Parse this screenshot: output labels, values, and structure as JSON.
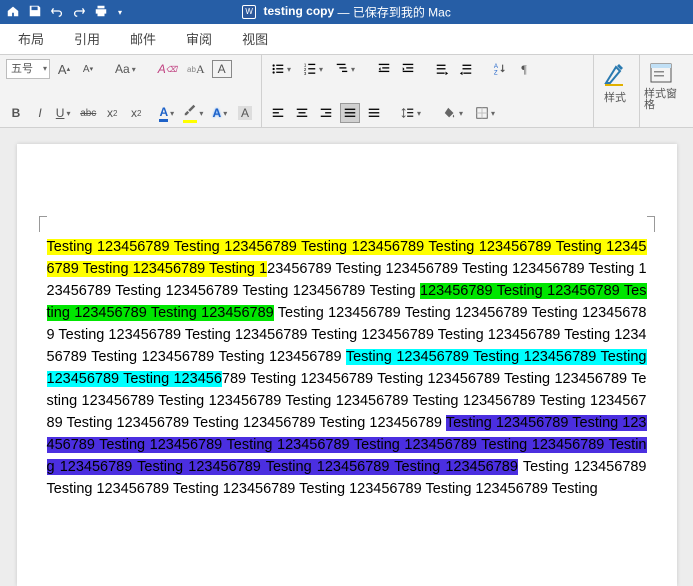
{
  "titlebar": {
    "doc_name": "testing copy",
    "status_text": " — 已保存到我的 Mac"
  },
  "tabs": {
    "t1": "布局",
    "t2": "引用",
    "t3": "邮件",
    "t4": "审阅",
    "t5": "视图"
  },
  "ribbon": {
    "font_size": "五号",
    "grow_font": "A",
    "shrink_font": "A",
    "change_case": "Aa",
    "clear_fmt": "A",
    "phonetic": "A",
    "char_border": "A",
    "bold": "B",
    "italic": "I",
    "underline": "U",
    "strike": "abc",
    "sub": "x",
    "sup": "x",
    "font_color": "A",
    "highlight": "ab",
    "char_shading": "A",
    "styles_label": "样式",
    "styles_pane_label": "样式窗格"
  },
  "content": {
    "seg_yellow": "Testing 123456789 Testing 123456789 Testing 123456789 Testing 123456789 Testing 123456789 Testing 123456789 Testing 1",
    "seg_plain1": "23456789 Testing 123456789 Testing 123456789 Testing 123456789 Testing 123456789 Testing 123456789 Testing ",
    "seg_green": "123456789 Testing 123456789 Testing 123456789 Testing 123456789",
    "seg_plain2": " Testing 123456789 Testing 123456789 Testing 123456789 Testing 123456789 Testing 123456789 Testing 123456789 Testing 123456789 Testing 123456789 Testing 123456789 Testing 123456789 ",
    "seg_cyan": "Testing 123456789 Testing 123456789 Testing 123456789 Testing 123456",
    "seg_plain3": "789 Testing 123456789 Testing 123456789 Testing 123456789 Testing 123456789 Testing 123456789 Testing 123456789 Testing 123456789 Testing 123456789 Testing 123456789 Testing 123456789 Testing 123456789 ",
    "seg_blue": "Testing 123456789 Testing 123456789 Testing 123456789 Testing 123456789 Testing 123456789 Testing 123456789 Testing 123456789 Testing 123456789 Testing 123456789 Testing 123456789",
    "seg_plain4": " Testing 123456789 Testing 123456789 Testing 123456789 Testing 123456789 Testing 123456789 Testing"
  }
}
